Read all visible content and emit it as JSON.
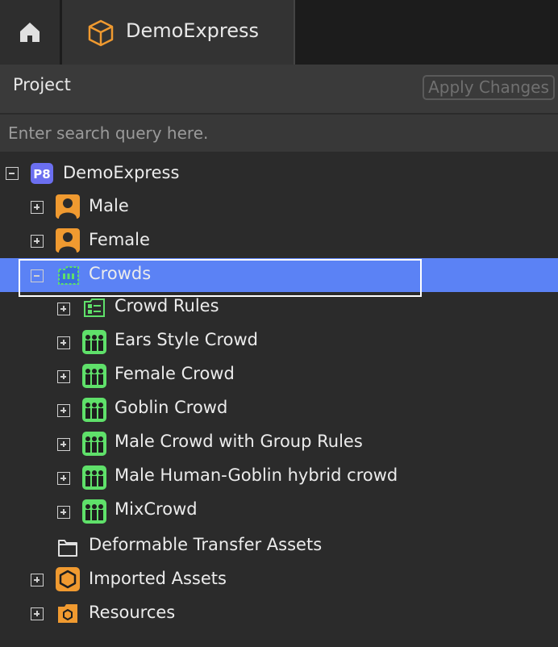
{
  "tabs": {
    "home_icon": "home-icon",
    "doc_icon": "cube-icon",
    "doc_title": "DemoExpress"
  },
  "header": {
    "title": "Project",
    "apply_label": "Apply Changes"
  },
  "search": {
    "placeholder": "Enter search query here."
  },
  "colors": {
    "selection": "#5b82f5",
    "accent_orange": "#f09a30",
    "crowd_green": "#5fe06a",
    "project_badge": "#6b6ff0"
  },
  "tree": {
    "root": {
      "label": "DemoExpress",
      "badge": "P8",
      "expander": "collapse",
      "icon": "project-badge-icon"
    },
    "items": [
      {
        "label": "Male",
        "expander": "expand",
        "icon": "person-icon"
      },
      {
        "label": "Female",
        "expander": "expand",
        "icon": "person-icon"
      },
      {
        "label": "Crowds",
        "expander": "collapse",
        "icon": "crowd-folder-icon",
        "selected": true
      },
      {
        "label": "Crowd Rules",
        "expander": "expand",
        "icon": "rules-icon"
      },
      {
        "label": "Ears Style Crowd",
        "expander": "expand",
        "icon": "crowd-icon"
      },
      {
        "label": "Female Crowd",
        "expander": "expand",
        "icon": "crowd-icon"
      },
      {
        "label": "Goblin Crowd",
        "expander": "expand",
        "icon": "crowd-icon"
      },
      {
        "label": "Male Crowd with Group Rules",
        "expander": "expand",
        "icon": "crowd-icon"
      },
      {
        "label": "Male Human-Goblin hybrid crowd",
        "expander": "expand",
        "icon": "crowd-icon"
      },
      {
        "label": "MixCrowd",
        "expander": "expand",
        "icon": "crowd-icon"
      },
      {
        "label": "Deformable Transfer Assets",
        "expander": "none",
        "icon": "folder-icon"
      },
      {
        "label": "Imported Assets",
        "expander": "expand",
        "icon": "hexagon-icon"
      },
      {
        "label": "Resources",
        "expander": "expand",
        "icon": "resource-folder-icon"
      }
    ]
  }
}
